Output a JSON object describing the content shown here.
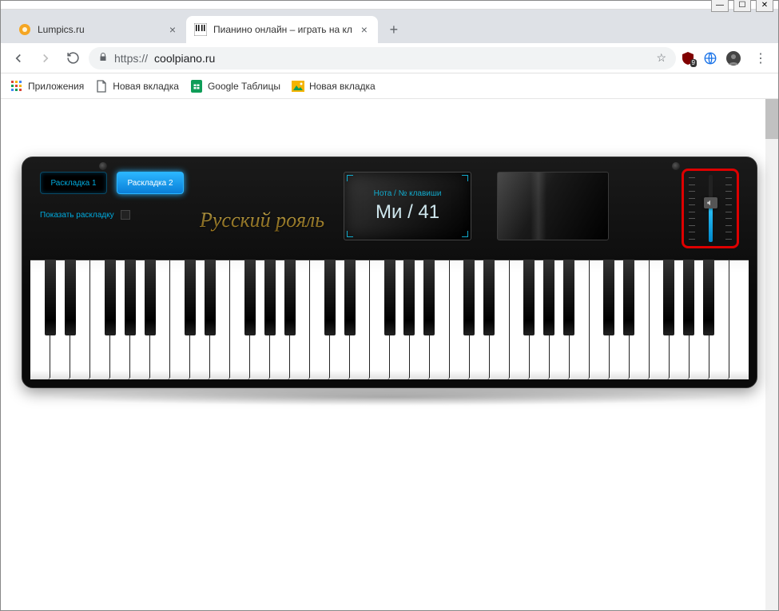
{
  "window_controls": {
    "min": "—",
    "max": "☐",
    "close": "✕"
  },
  "tabs": [
    {
      "title": "Lumpics.ru",
      "active": false,
      "favicon_color": "#f5a623"
    },
    {
      "title": "Пианино онлайн – играть на кл",
      "active": true,
      "favicon_piano": true
    }
  ],
  "newtab": "+",
  "nav": {
    "back": "←",
    "forward": "→",
    "reload": "⟳"
  },
  "omnibox": {
    "scheme": "https://",
    "url": "coolpiano.ru",
    "lock": "🔒",
    "star": "☆"
  },
  "extensions": {
    "ublock_badge": "9",
    "globe": "🌐"
  },
  "menu": "⋮",
  "bookmarks": [
    {
      "label": "Приложения",
      "icon": "apps"
    },
    {
      "label": "Новая вкладка",
      "icon": "page"
    },
    {
      "label": "Google Таблицы",
      "icon": "sheets"
    },
    {
      "label": "Новая вкладка",
      "icon": "picture"
    }
  ],
  "piano": {
    "layout1": "Раскладка 1",
    "layout2": "Раскладка 2",
    "show_layout": "Показать раскладку",
    "brand": "Русский рояль",
    "note_label": "Нота / № клавиши",
    "note_value": "Ми / 41",
    "volume_icon": "🔇",
    "white_keys": 36,
    "black_pattern": [
      1,
      1,
      0,
      1,
      1,
      1,
      0
    ]
  }
}
